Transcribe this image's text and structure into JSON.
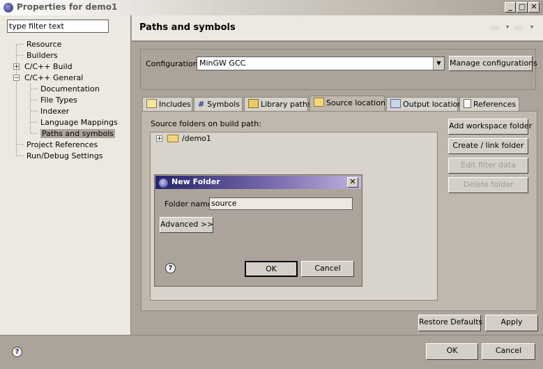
{
  "window": {
    "title": "Properties for demo1"
  },
  "filter": {
    "placeholder": "type filter text"
  },
  "tree": {
    "resource": "Resource",
    "builders": "Builders",
    "cpp_build": "C/C++ Build",
    "cpp_general": "C/C++ General",
    "documentation": "Documentation",
    "file_types": "File Types",
    "indexer": "Indexer",
    "language_mappings": "Language Mappings",
    "paths_symbols": "Paths and symbols",
    "project_references": "Project References",
    "run_debug": "Run/Debug Settings"
  },
  "page": {
    "title": "Paths and symbols"
  },
  "config": {
    "label": "Configuration:",
    "value": "MinGW GCC",
    "manage_label": "Manage configurations"
  },
  "tabs": {
    "includes": "Includes",
    "symbols": "Symbols",
    "library_paths": "Library paths",
    "source_location": "Source location",
    "output_location": "Output location",
    "references": "References"
  },
  "source": {
    "heading": "Source folders on build path:",
    "folder": "/demo1",
    "add_workspace": "Add workspace folder",
    "create_link": "Create / link folder",
    "edit_filter": "Edit filter data",
    "delete_folder": "Delete folder"
  },
  "dialog": {
    "title": "New Folder",
    "name_label": "Folder name:",
    "name_value": "source",
    "advanced": "Advanced >>",
    "ok": "OK",
    "cancel": "Cancel"
  },
  "actions": {
    "restore_defaults": "Restore Defaults",
    "apply": "Apply",
    "ok": "OK",
    "cancel": "Cancel"
  }
}
